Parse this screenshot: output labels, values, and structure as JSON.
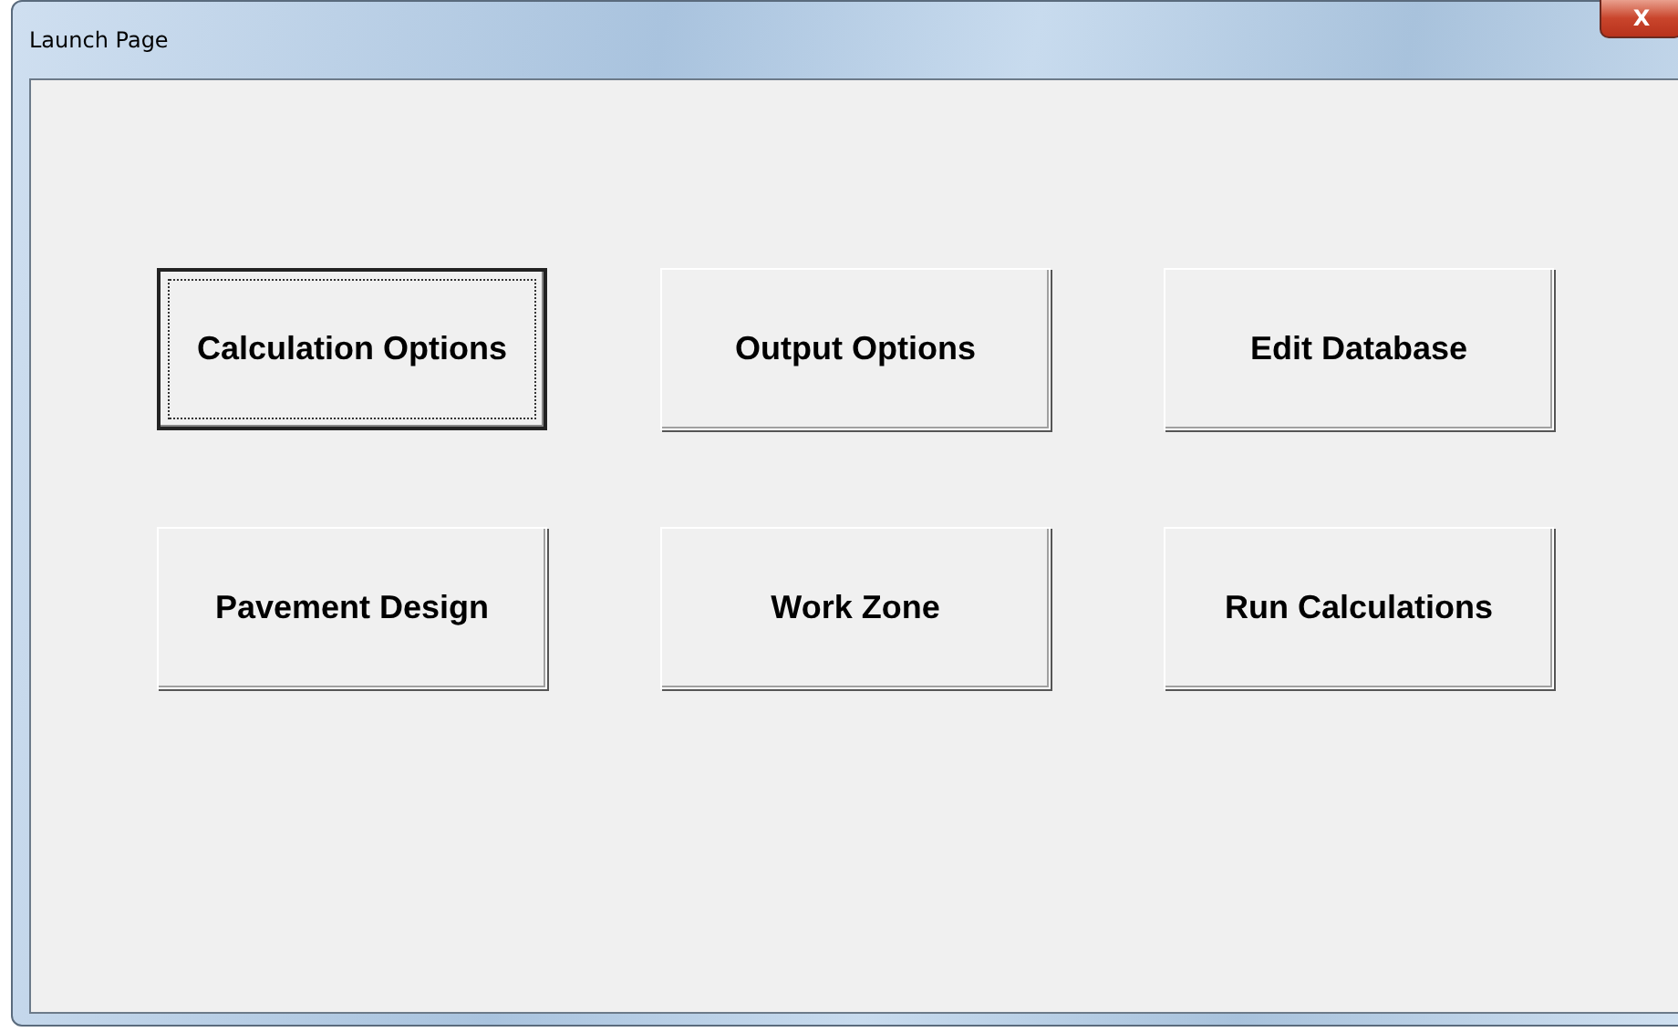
{
  "window": {
    "title": "Launch Page",
    "close_label": "X"
  },
  "buttons": [
    {
      "label": "Calculation Options",
      "focused": true
    },
    {
      "label": "Output Options",
      "focused": false
    },
    {
      "label": "Edit Database",
      "focused": false
    },
    {
      "label": "Pavement Design",
      "focused": false
    },
    {
      "label": "Work Zone",
      "focused": false
    },
    {
      "label": "Run Calculations",
      "focused": false
    }
  ]
}
